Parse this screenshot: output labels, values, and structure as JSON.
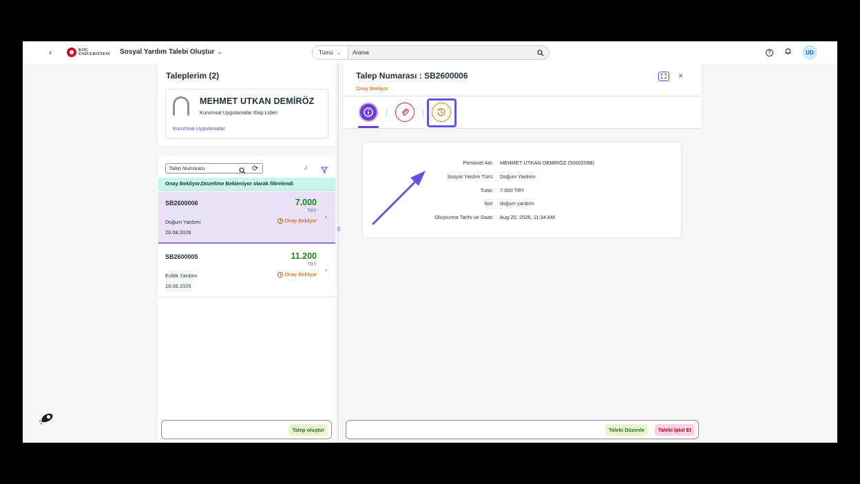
{
  "shell": {
    "back_icon": "back-chevron-icon",
    "logo_text_1": "KOÇ",
    "logo_text_2": "ÜNİVERSİTESİ",
    "app_title": "Sosyal Yardım Talebi Oluştur",
    "search_scope": "Tümü",
    "search_placeholder": "Arama",
    "avatar_initials": "UD"
  },
  "list": {
    "title": "Taleplerim (2)",
    "profile": {
      "name": "MEHMET UTKAN DEMİRÖZ",
      "role": "Kurumsal Uygulamalar Ekip Lideri",
      "department": "Kurumsal Uygulamalar"
    },
    "filter_placeholder": "Talep Numarası",
    "filter_banner": "Onay Bekliyor,Düzeltme Bekleniyor olarak filtrelendi",
    "items": [
      {
        "code": "SB2600006",
        "amount": "7.000",
        "currency": "TRY",
        "type": "Doğum Yardımı",
        "date": "20.08.2026",
        "status": "Onay Bekliyor"
      },
      {
        "code": "SB2600005",
        "amount": "11.200",
        "currency": "TRY",
        "type": "Evlilik Yardımı",
        "date": "18.08.2026",
        "status": "Onay Bekliyor"
      }
    ],
    "create_button": "Talep oluştur"
  },
  "detail": {
    "title": "Talep Numarası : SB2600006",
    "status": "Onay Bekliyor",
    "fields": [
      {
        "label": "Personel Adı:",
        "value": "MEHMET UTKAN DEMİRÖZ (50002598)"
      },
      {
        "label": "Sosyal Yardım Türü:",
        "value": "Doğum Yardımı"
      },
      {
        "label": "Tutar:",
        "value": "7.000 TRY"
      },
      {
        "label": "Not:",
        "value": "doğum yardımı"
      },
      {
        "label": "Oluşturma Tarihi ve Saati:",
        "value": "Aug 20, 2026, 11:34 AM"
      }
    ],
    "edit_button": "Talebi Düzenle",
    "cancel_button": "Talebi İptal Et"
  },
  "colors": {
    "accent": "#6b3fd6",
    "status_orange": "#c35500",
    "amount_green": "#188918",
    "highlight": "#5b54e6"
  }
}
